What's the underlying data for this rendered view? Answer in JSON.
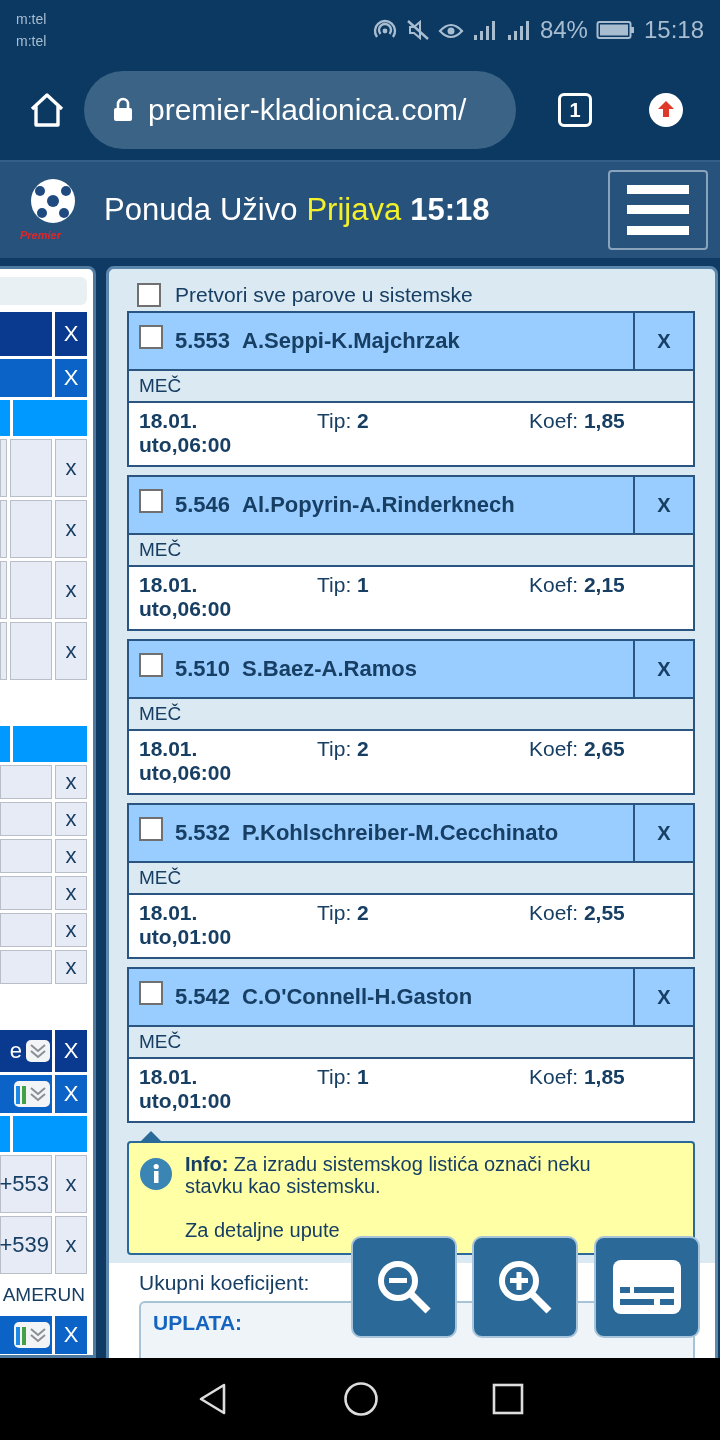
{
  "status_bar": {
    "carriers": [
      "m:tel",
      "m:tel"
    ],
    "battery": "84%",
    "time": "15:18"
  },
  "browser": {
    "url": "premier-kladionica.com/",
    "tab_count": "1"
  },
  "site_header": {
    "logo_text": "Premier",
    "nav": [
      {
        "label": "Ponuda",
        "highlighted": false
      },
      {
        "label": "Uživo",
        "highlighted": false
      },
      {
        "label": "Prijava",
        "highlighted": true
      }
    ],
    "time": "15:18"
  },
  "left_panel": {
    "rows": [
      {
        "kind": "input"
      },
      {
        "kind": "dark",
        "close": "X"
      },
      {
        "kind": "blue",
        "close": "X"
      },
      {
        "kind": "header"
      },
      {
        "kind": "tall",
        "close": "x"
      },
      {
        "kind": "tall",
        "close": "x"
      },
      {
        "kind": "tall",
        "close": "x"
      },
      {
        "kind": "tall",
        "close": "x"
      },
      {
        "kind": "gap"
      },
      {
        "kind": "header"
      },
      {
        "kind": "short",
        "close": "x"
      },
      {
        "kind": "short",
        "close": "x"
      },
      {
        "kind": "short",
        "close": "x"
      },
      {
        "kind": "short",
        "close": "x"
      },
      {
        "kind": "short",
        "close": "x"
      },
      {
        "kind": "short",
        "close": "x"
      },
      {
        "kind": "gap"
      },
      {
        "kind": "dark-select",
        "text": "e",
        "close": "X"
      },
      {
        "kind": "blue-select",
        "close": "X"
      },
      {
        "kind": "header"
      },
      {
        "kind": "value",
        "text": "+553",
        "close": "x"
      },
      {
        "kind": "value",
        "text": "+539",
        "close": "x"
      },
      {
        "kind": "label",
        "text": "AMERUN"
      },
      {
        "kind": "blue-select",
        "close": "X"
      }
    ]
  },
  "slip": {
    "convert_all": {
      "label": "Pretvori sve parove u sistemske",
      "checked": false
    },
    "bets": [
      {
        "checked": false,
        "code": "5.553",
        "match": "A.Seppi-K.Majchrzak",
        "remove": "X",
        "market": "MEČ",
        "date": "18.01.",
        "time": "uto,06:00",
        "tip_label": "Tip:",
        "tip": "2",
        "odds_label": "Koef:",
        "odds": "1,85"
      },
      {
        "checked": false,
        "code": "5.546",
        "match": "Al.Popyrin-A.Rinderknech",
        "remove": "X",
        "market": "MEČ",
        "date": "18.01.",
        "time": "uto,06:00",
        "tip_label": "Tip:",
        "tip": "1",
        "odds_label": "Koef:",
        "odds": "2,15"
      },
      {
        "checked": false,
        "code": "5.510",
        "match": "S.Baez-A.Ramos",
        "remove": "X",
        "market": "MEČ",
        "date": "18.01.",
        "time": "uto,06:00",
        "tip_label": "Tip:",
        "tip": "2",
        "odds_label": "Koef:",
        "odds": "2,65"
      },
      {
        "checked": false,
        "code": "5.532",
        "match": "P.Kohlschreiber-M.Cecchinato",
        "remove": "X",
        "market": "MEČ",
        "date": "18.01.",
        "time": "uto,01:00",
        "tip_label": "Tip:",
        "tip": "2",
        "odds_label": "Koef:",
        "odds": "2,55"
      },
      {
        "checked": false,
        "code": "5.542",
        "match": "C.O'Connell-H.Gaston",
        "remove": "X",
        "market": "MEČ",
        "date": "18.01.",
        "time": "uto,01:00",
        "tip_label": "Tip:",
        "tip": "1",
        "odds_label": "Koef:",
        "odds": "1,85"
      }
    ],
    "info": {
      "text": "**Info:** Za izradu sistemskog listića označi neku stavku kao sistemsku.",
      "link_prefix": "Za detaljne upute"
    },
    "total_label": "Ukupni koeficijent:",
    "stake_label": "UPLATA:"
  }
}
